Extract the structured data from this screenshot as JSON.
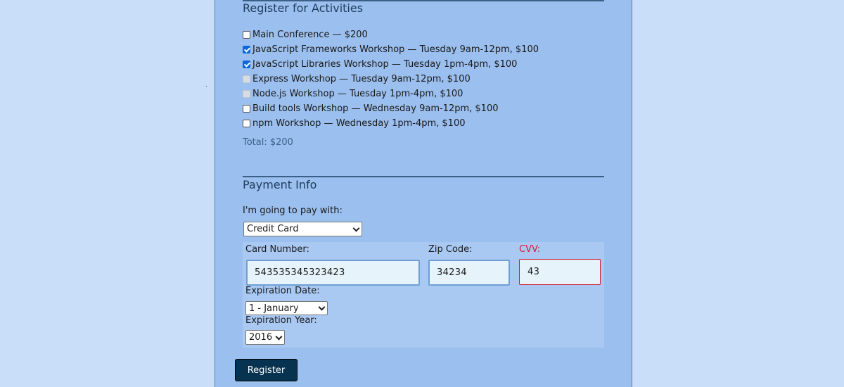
{
  "activities": {
    "legend": "Register for Activities",
    "items": [
      {
        "label": "Main Conference — $200",
        "checked": false,
        "disabled": false
      },
      {
        "label": "JavaScript Frameworks Workshop — Tuesday 9am-12pm, $100",
        "checked": true,
        "disabled": false
      },
      {
        "label": "JavaScript Libraries Workshop — Tuesday 1pm-4pm, $100",
        "checked": true,
        "disabled": false
      },
      {
        "label": "Express Workshop — Tuesday 9am-12pm, $100",
        "checked": false,
        "disabled": true
      },
      {
        "label": "Node.js Workshop — Tuesday 1pm-4pm, $100",
        "checked": false,
        "disabled": true
      },
      {
        "label": "Build tools Workshop — Wednesday 9am-12pm, $100",
        "checked": false,
        "disabled": false
      },
      {
        "label": "npm Workshop — Wednesday 1pm-4pm, $100",
        "checked": false,
        "disabled": false
      }
    ],
    "total": "Total: $200"
  },
  "payment": {
    "legend": "Payment Info",
    "method_label": "I'm going to pay with:",
    "method_value": "Credit Card",
    "card_number_label": "Card Number:",
    "card_number_value": "543535345323423",
    "zip_label": "Zip Code:",
    "zip_value": "34234",
    "cvv_label": "CVV:",
    "cvv_value": "43",
    "exp_date_label": "Expiration Date:",
    "exp_date_value": "1 - January",
    "exp_year_label": "Expiration Year:",
    "exp_year_value": "2016"
  },
  "register_label": "Register",
  "colors": {
    "page_bg": "#c9def9",
    "form_bg": "#9bbfee",
    "button_bg": "#083350",
    "error": "#d11d2e",
    "checkbox_checked": "#0d67d9"
  }
}
